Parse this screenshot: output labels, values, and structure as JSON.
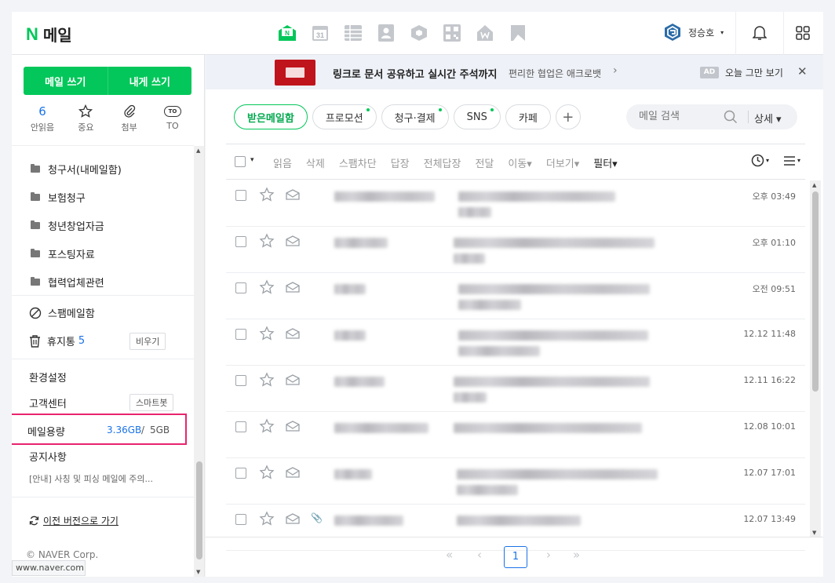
{
  "brand": {
    "n": "N",
    "title": "메일"
  },
  "header": {
    "user": "정승호",
    "app_icons": [
      "mail-icon",
      "calendar-icon",
      "table-icon",
      "contacts-icon",
      "box-icon",
      "qr-icon",
      "home-icon",
      "bookmark-icon"
    ],
    "calendar_day": "31",
    "logo_mark": "N"
  },
  "sidebar": {
    "compose": "메일 쓰기",
    "self_compose": "내게 쓰기",
    "quick": [
      {
        "value": "6",
        "label": "안읽음"
      },
      {
        "value": "",
        "label": "중요"
      },
      {
        "value": "",
        "label": "첨부"
      },
      {
        "value": "TO",
        "label": "TO"
      }
    ],
    "folders": [
      "청구서(내메일함)",
      "보험청구",
      "청년창업자금",
      "포스팅자료",
      "협력업체관련"
    ],
    "spam": "스팸메일함",
    "trash": {
      "label": "휴지통",
      "count": "5",
      "empty_btn": "비우기"
    },
    "settings": "환경설정",
    "support": {
      "label": "고객센터",
      "smartbot": "스마트봇"
    },
    "quota": {
      "label": "메일용량",
      "used": "3.36GB",
      "sep": "/",
      "total": "5GB"
    },
    "notice": "공지사항",
    "notice_text": "[안내] 사칭 및 피싱 메일에 주의...",
    "old_version": "이전 버전으로 가기",
    "copyright": "© NAVER Corp.",
    "status_url": "www.naver.com"
  },
  "ad": {
    "title": "링크로 문서 공유하고 실시간 주석까지",
    "sub": "편리한 협업은 애크로뱃",
    "chevron": "›",
    "badge": "AD",
    "dismiss": "오늘 그만 보기",
    "close": "✕"
  },
  "tabs": [
    {
      "label": "받은메일함",
      "active": true,
      "dot": false
    },
    {
      "label": "프로모션",
      "active": false,
      "dot": true
    },
    {
      "label": "청구·결제",
      "active": false,
      "dot": true
    },
    {
      "label": "SNS",
      "active": false,
      "dot": true
    },
    {
      "label": "카페",
      "active": false,
      "dot": false
    }
  ],
  "tab_add": "+",
  "search": {
    "placeholder": "메일 검색",
    "detail": "상세 ▾"
  },
  "toolbar": {
    "caret": "▾",
    "actions": [
      "읽음",
      "삭제",
      "스팸차단",
      "답장",
      "전체답장",
      "전달",
      "이동▾",
      "더보기▾",
      "필터▾"
    ]
  },
  "mails": [
    {
      "date": "오후 03:49",
      "attach": false
    },
    {
      "date": "오후 01:10",
      "attach": false
    },
    {
      "date": "오전 09:51",
      "attach": false
    },
    {
      "date": "12.12 11:48",
      "attach": false
    },
    {
      "date": "12.11 16:22",
      "attach": false
    },
    {
      "date": "12.08 10:01",
      "attach": false
    },
    {
      "date": "12.07 17:01",
      "attach": false
    },
    {
      "date": "12.07 13:49",
      "attach": true
    }
  ],
  "pager": {
    "first": "«",
    "prev": "‹",
    "current": "1",
    "next": "›",
    "last": "»"
  }
}
